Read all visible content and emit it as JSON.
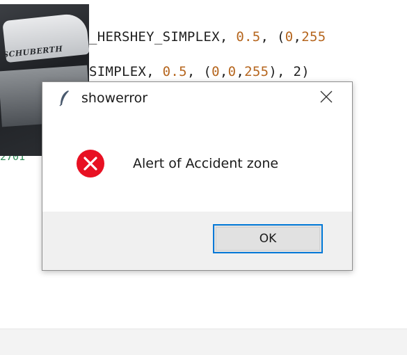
{
  "editor": {
    "line1": {
      "code": "_HERSHEY_SIMPLEX, ",
      "num": "0.5",
      "rest": ", (",
      "num2": "0",
      "sep": ",",
      "num3": "255"
    },
    "line2": {
      "code": "SIMPLEX, ",
      "num": "0.5",
      "open": ", (",
      "n1": "0",
      "c1": ",",
      "n2": "0",
      "c2": ",",
      "n3": "255",
      "close": "), 2)"
    },
    "line_number": "2701"
  },
  "thumbnail": {
    "brand_text": "SCHUBERTH"
  },
  "dialog": {
    "title": "showerror",
    "message": "Alert of Accident zone",
    "ok_label": "OK",
    "icons": {
      "app": "feather-icon",
      "close": "close-icon",
      "status": "error-icon"
    },
    "colors": {
      "error": "#e81123",
      "focus": "#0078d7",
      "footer": "#f0f0f0"
    }
  }
}
